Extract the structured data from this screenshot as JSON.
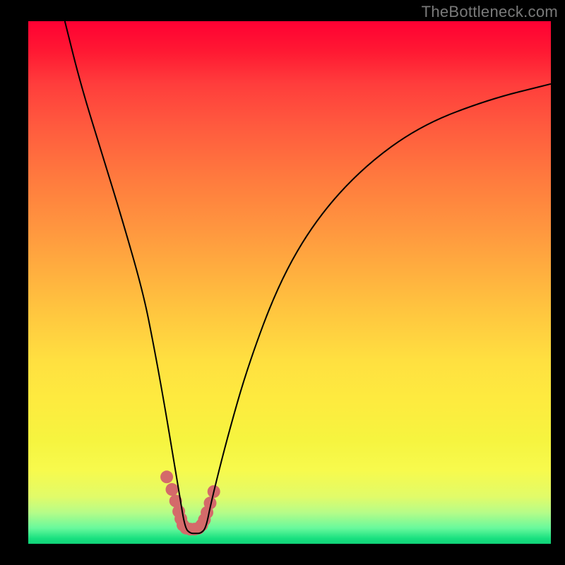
{
  "watermark": "TheBottleneck.com",
  "chart_data": {
    "type": "line",
    "title": "",
    "xlabel": "",
    "ylabel": "",
    "xlim": [
      0,
      100
    ],
    "ylim": [
      0,
      100
    ],
    "series": [
      {
        "name": "bottleneck-curve",
        "x": [
          7,
          10,
          14,
          18,
          22,
          24,
          26,
          28,
          29,
          30,
          31,
          32,
          33,
          34,
          35,
          38,
          42,
          48,
          55,
          64,
          75,
          88,
          100
        ],
        "values": [
          100,
          88,
          75,
          62,
          48,
          38,
          27,
          15,
          9,
          3,
          2,
          2,
          2,
          3,
          8,
          20,
          34,
          50,
          62,
          72,
          80,
          85,
          88
        ],
        "color": "#000000",
        "width": 2
      },
      {
        "name": "trough-markers",
        "x": [
          26.5,
          27.5,
          28.2,
          28.8,
          29.2,
          29.6,
          30.2,
          31.0,
          31.8,
          32.6,
          33.2,
          33.7,
          34.2,
          34.8,
          35.5
        ],
        "values": [
          12.8,
          10.4,
          8.2,
          6.2,
          4.8,
          3.6,
          3.0,
          2.8,
          2.8,
          3.0,
          3.6,
          4.6,
          6.0,
          7.8,
          10.0
        ],
        "color": "#d46a6a",
        "marker_radius": 9
      }
    ],
    "background_gradient": {
      "top": "#ff0033",
      "mid1": "#ff7a3e",
      "mid2": "#ffe040",
      "bottom": "#11d178"
    }
  }
}
